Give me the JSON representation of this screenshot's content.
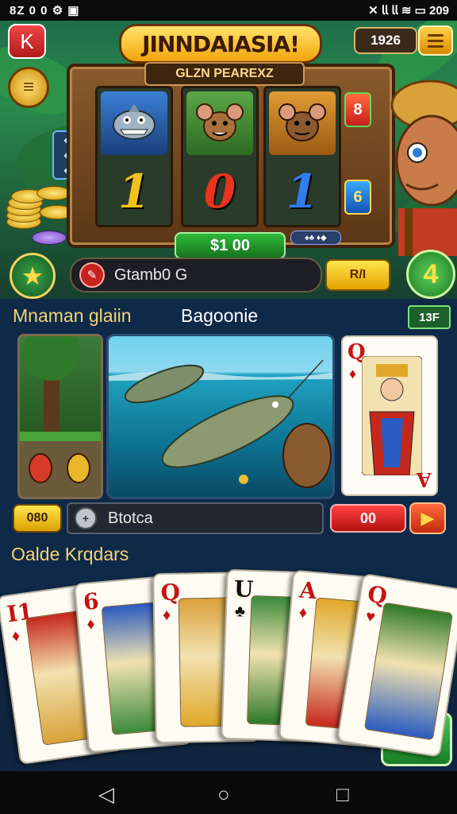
{
  "status_bar": {
    "left": "8Z 0 0 ⚙ ▣",
    "right": "✕ 𝗅𝗅 𝗅𝗅 ≋ ▭ 209"
  },
  "header": {
    "back_label": "K",
    "logo_text": "JINNDAIASIA!",
    "coin_count": "1926"
  },
  "slot": {
    "title": "GLZN PEAREXZ",
    "reels": [
      {
        "top_icon": "shark-icon",
        "number": "1",
        "number_color": "#f2c21a"
      },
      {
        "top_icon": "rat-icon",
        "number": "0",
        "number_color": "#e8341c"
      },
      {
        "top_icon": "rat-icon",
        "number": "1",
        "number_color": "#2f7df0"
      }
    ],
    "side_right_top": "8",
    "side_right_bottom": "6",
    "win_amount": "$1 00",
    "small_tag": "♠♣ ♦◆"
  },
  "controls": {
    "search_value": "Gtamb0 G",
    "bet_label": "R/I",
    "plus_label": "4"
  },
  "section2": {
    "title_left": "Mnaman glaiin",
    "title_center": "Bagoonie",
    "badge": "13F",
    "queen_card": {
      "rank": "Q",
      "corner_rank": "A"
    },
    "count_left": "080",
    "field_text": "Btotca",
    "red_amount": "00"
  },
  "section3": {
    "title": "Oalde Krqdars",
    "cards": [
      {
        "rank": "I1",
        "suit": "♦",
        "color": "#c41414"
      },
      {
        "rank": "6",
        "suit": "♦",
        "color": "#c41414"
      },
      {
        "rank": "Q",
        "suit": "♦",
        "color": "#c41414"
      },
      {
        "rank": "U",
        "suit": "♣",
        "color": "#111111"
      },
      {
        "rank": "A",
        "suit": "♦",
        "color": "#c41414"
      },
      {
        "rank": "Q",
        "suit": "♥",
        "color": "#c41414"
      }
    ]
  }
}
